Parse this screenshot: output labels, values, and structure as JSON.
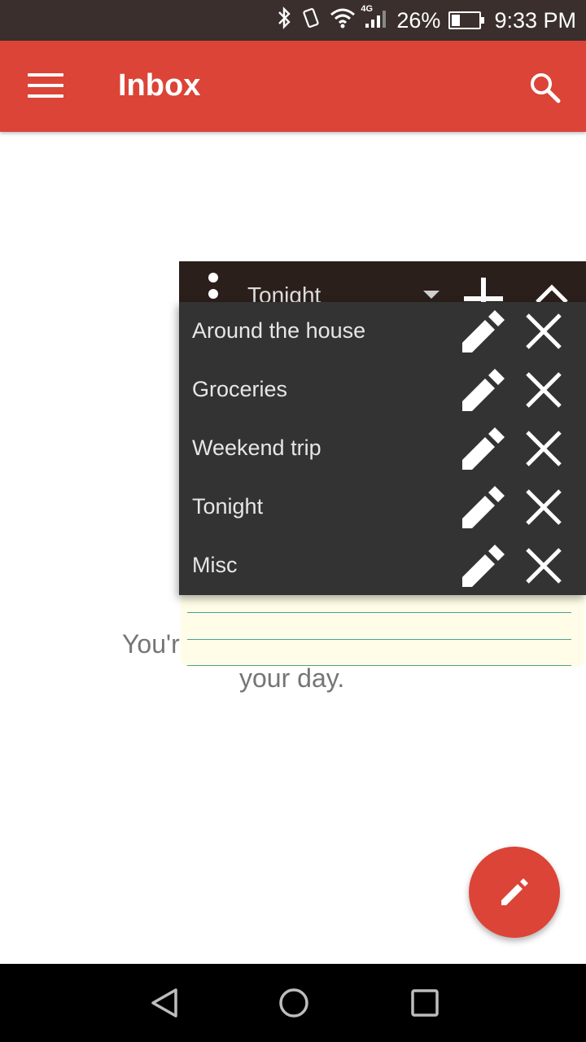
{
  "status_bar": {
    "network": "4G",
    "battery_percent": "26%",
    "battery_level": 0.26,
    "time": "9:33 PM",
    "icons": [
      "bluetooth-icon",
      "vibrate-icon",
      "wifi-icon",
      "signal-icon",
      "battery-icon"
    ]
  },
  "app_bar": {
    "title": "Inbox",
    "menu_icon": "hamburger-menu-icon",
    "search_icon": "search-icon",
    "color": "#db4437"
  },
  "empty_state": {
    "line1": "You'r",
    "line2": "your day."
  },
  "widget": {
    "selected_list": "Tonight",
    "header_icons": [
      "overflow-icon",
      "dropdown-arrow-icon",
      "add-icon",
      "collapse-icon"
    ],
    "lists": [
      {
        "label": "Around the house"
      },
      {
        "label": "Groceries"
      },
      {
        "label": "Weekend trip"
      },
      {
        "label": "Tonight"
      },
      {
        "label": "Misc"
      }
    ]
  },
  "fab": {
    "icon": "pencil-icon"
  },
  "nav_bar": {
    "icons": [
      "back-icon",
      "home-icon",
      "recents-icon"
    ]
  }
}
